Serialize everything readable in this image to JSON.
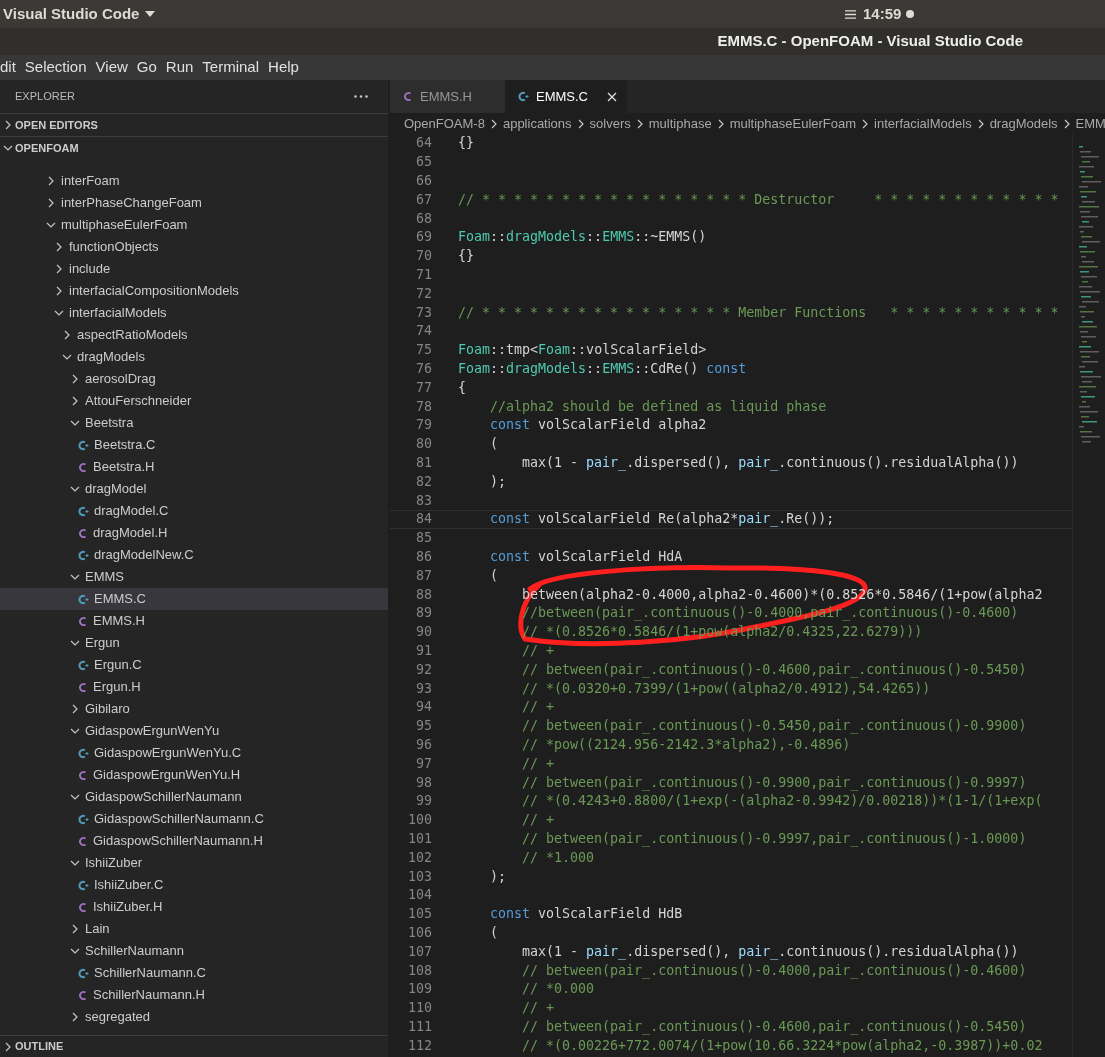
{
  "top_bar": {
    "app_menu": "Visual Studio Code",
    "clock": "14:59"
  },
  "window": {
    "title": "EMMS.C - OpenFOAM - Visual Studio Code"
  },
  "menu": [
    "dit",
    "Selection",
    "View",
    "Go",
    "Run",
    "Terminal",
    "Help"
  ],
  "sidebar": {
    "title": "EXPLORER",
    "sections": [
      {
        "label": "OPEN EDITORS",
        "expanded": false
      },
      {
        "label": "OPENFOAM",
        "expanded": true
      }
    ],
    "outline": {
      "label": "OUTLINE",
      "expanded": false
    },
    "tree": [
      {
        "label": "interFoam",
        "kind": "folder",
        "expanded": false,
        "selected": false
      },
      {
        "label": "interPhaseChangeFoam",
        "kind": "folder",
        "expanded": false,
        "selected": false
      },
      {
        "label": "multiphaseEulerFoam",
        "kind": "folder",
        "expanded": true,
        "selected": false,
        "children": [
          {
            "label": "functionObjects",
            "kind": "folder",
            "expanded": false,
            "selected": false
          },
          {
            "label": "include",
            "kind": "folder",
            "expanded": false,
            "selected": false
          },
          {
            "label": "interfacialCompositionModels",
            "kind": "folder",
            "expanded": false,
            "selected": false
          },
          {
            "label": "interfacialModels",
            "kind": "folder",
            "expanded": true,
            "selected": false,
            "children": [
              {
                "label": "aspectRatioModels",
                "kind": "folder",
                "expanded": false,
                "selected": false
              },
              {
                "label": "dragModels",
                "kind": "folder",
                "expanded": true,
                "selected": false,
                "children": [
                  {
                    "label": "aerosolDrag",
                    "kind": "folder",
                    "expanded": false,
                    "selected": false
                  },
                  {
                    "label": "AttouFerschneider",
                    "kind": "folder",
                    "expanded": false,
                    "selected": false
                  },
                  {
                    "label": "Beetstra",
                    "kind": "folder",
                    "expanded": true,
                    "selected": false,
                    "children": [
                      {
                        "label": "Beetstra.C",
                        "kind": "source",
                        "selected": false
                      },
                      {
                        "label": "Beetstra.H",
                        "kind": "header",
                        "selected": false
                      }
                    ]
                  },
                  {
                    "label": "dragModel",
                    "kind": "folder",
                    "expanded": true,
                    "selected": false,
                    "children": [
                      {
                        "label": "dragModel.C",
                        "kind": "source",
                        "selected": false
                      },
                      {
                        "label": "dragModel.H",
                        "kind": "header",
                        "selected": false
                      },
                      {
                        "label": "dragModelNew.C",
                        "kind": "source",
                        "selected": false
                      }
                    ]
                  },
                  {
                    "label": "EMMS",
                    "kind": "folder",
                    "expanded": true,
                    "selected": false,
                    "children": [
                      {
                        "label": "EMMS.C",
                        "kind": "source",
                        "selected": true
                      },
                      {
                        "label": "EMMS.H",
                        "kind": "header",
                        "selected": false
                      }
                    ]
                  },
                  {
                    "label": "Ergun",
                    "kind": "folder",
                    "expanded": true,
                    "selected": false,
                    "children": [
                      {
                        "label": "Ergun.C",
                        "kind": "source",
                        "selected": false
                      },
                      {
                        "label": "Ergun.H",
                        "kind": "header",
                        "selected": false
                      }
                    ]
                  },
                  {
                    "label": "Gibilaro",
                    "kind": "folder",
                    "expanded": false,
                    "selected": false
                  },
                  {
                    "label": "GidaspowErgunWenYu",
                    "kind": "folder",
                    "expanded": true,
                    "selected": false,
                    "children": [
                      {
                        "label": "GidaspowErgunWenYu.C",
                        "kind": "source",
                        "selected": false
                      },
                      {
                        "label": "GidaspowErgunWenYu.H",
                        "kind": "header",
                        "selected": false
                      }
                    ]
                  },
                  {
                    "label": "GidaspowSchillerNaumann",
                    "kind": "folder",
                    "expanded": true,
                    "selected": false,
                    "children": [
                      {
                        "label": "GidaspowSchillerNaumann.C",
                        "kind": "source",
                        "selected": false
                      },
                      {
                        "label": "GidaspowSchillerNaumann.H",
                        "kind": "header",
                        "selected": false
                      }
                    ]
                  },
                  {
                    "label": "IshiiZuber",
                    "kind": "folder",
                    "expanded": true,
                    "selected": false,
                    "children": [
                      {
                        "label": "IshiiZuber.C",
                        "kind": "source",
                        "selected": false
                      },
                      {
                        "label": "IshiiZuber.H",
                        "kind": "header",
                        "selected": false
                      }
                    ]
                  },
                  {
                    "label": "Lain",
                    "kind": "folder",
                    "expanded": false,
                    "selected": false
                  },
                  {
                    "label": "SchillerNaumann",
                    "kind": "folder",
                    "expanded": true,
                    "selected": false,
                    "children": [
                      {
                        "label": "SchillerNaumann.C",
                        "kind": "source",
                        "selected": false
                      },
                      {
                        "label": "SchillerNaumann.H",
                        "kind": "header",
                        "selected": false
                      }
                    ]
                  },
                  {
                    "label": "segregated",
                    "kind": "folder",
                    "expanded": false,
                    "selected": false
                  }
                ]
              }
            ]
          }
        ]
      }
    ]
  },
  "tabs": [
    {
      "label": "EMMS.H",
      "kind": "header",
      "selected": false
    },
    {
      "label": "EMMS.C",
      "kind": "source",
      "selected": true
    }
  ],
  "breadcrumbs": [
    "OpenFOAM-8",
    "applications",
    "solvers",
    "multiphase",
    "multiphaseEulerFoam",
    "interfacialModels",
    "dragModels",
    "EMM"
  ],
  "editor": {
    "lines": [
      {
        "number": "64",
        "current": false,
        "tokens": [
          {
            "text": "{}",
            "kind": "plain"
          }
        ]
      },
      {
        "number": "65",
        "current": false
      },
      {
        "number": "66",
        "current": false
      },
      {
        "number": "67",
        "current": false,
        "tokens": [
          {
            "text": "// * * * * * * * * * * * * * * * * * Destructor     * * * * * * * * * * * *",
            "kind": "comment"
          }
        ]
      },
      {
        "number": "68",
        "current": false
      },
      {
        "number": "69",
        "current": false,
        "tokens": [
          {
            "text": "Foam",
            "kind": "type"
          },
          {
            "text": "::",
            "kind": "plain"
          },
          {
            "text": "dragModels",
            "kind": "type"
          },
          {
            "text": "::",
            "kind": "plain"
          },
          {
            "text": "EMMS",
            "kind": "type"
          },
          {
            "text": "::~EMMS()",
            "kind": "plain"
          }
        ]
      },
      {
        "number": "70",
        "current": false,
        "tokens": [
          {
            "text": "{}",
            "kind": "plain"
          }
        ]
      },
      {
        "number": "71",
        "current": false
      },
      {
        "number": "72",
        "current": false
      },
      {
        "number": "73",
        "current": false,
        "tokens": [
          {
            "text": "// * * * * * * * * * * * * * * * * Member Functions   * * * * * * * * * * *",
            "kind": "comment"
          }
        ]
      },
      {
        "number": "74",
        "current": false
      },
      {
        "number": "75",
        "current": false,
        "tokens": [
          {
            "text": "Foam",
            "kind": "type"
          },
          {
            "text": "::tmp<",
            "kind": "plain"
          },
          {
            "text": "Foam",
            "kind": "type"
          },
          {
            "text": "::volScalarField>",
            "kind": "plain"
          }
        ]
      },
      {
        "number": "76",
        "current": false,
        "tokens": [
          {
            "text": "Foam",
            "kind": "type"
          },
          {
            "text": "::",
            "kind": "plain"
          },
          {
            "text": "dragModels",
            "kind": "type"
          },
          {
            "text": "::",
            "kind": "plain"
          },
          {
            "text": "EMMS",
            "kind": "type"
          },
          {
            "text": "::CdRe() ",
            "kind": "plain"
          },
          {
            "text": "const",
            "kind": "keyword"
          }
        ]
      },
      {
        "number": "77",
        "current": false,
        "tokens": [
          {
            "text": "{",
            "kind": "plain"
          }
        ]
      },
      {
        "number": "78",
        "current": false,
        "tokens": [
          {
            "text": "    //alpha2 should be defined as liquid phase",
            "kind": "comment"
          }
        ]
      },
      {
        "number": "79",
        "current": false,
        "tokens": [
          {
            "text": "    const",
            "kind": "keyword"
          },
          {
            "text": " volScalarField alpha2",
            "kind": "plain"
          }
        ]
      },
      {
        "number": "80",
        "current": false,
        "tokens": [
          {
            "text": "    (",
            "kind": "plain"
          }
        ]
      },
      {
        "number": "81",
        "current": false,
        "tokens": [
          {
            "text": "        max(1 - ",
            "kind": "plain"
          },
          {
            "text": "pair_",
            "kind": "variable"
          },
          {
            "text": ".dispersed(), ",
            "kind": "plain"
          },
          {
            "text": "pair_",
            "kind": "variable"
          },
          {
            "text": ".continuous().residualAlpha())",
            "kind": "plain"
          }
        ]
      },
      {
        "number": "82",
        "current": false,
        "tokens": [
          {
            "text": "    );",
            "kind": "plain"
          }
        ]
      },
      {
        "number": "83",
        "current": false
      },
      {
        "number": "84",
        "current": true,
        "tokens": [
          {
            "text": "    const",
            "kind": "keyword"
          },
          {
            "text": " volScalarField Re(alpha2*",
            "kind": "plain"
          },
          {
            "text": "pair_",
            "kind": "variable"
          },
          {
            "text": ".Re());",
            "kind": "plain"
          }
        ]
      },
      {
        "number": "85",
        "current": false
      },
      {
        "number": "86",
        "current": false,
        "tokens": [
          {
            "text": "    const",
            "kind": "keyword"
          },
          {
            "text": " volScalarField HdA",
            "kind": "plain"
          }
        ]
      },
      {
        "number": "87",
        "current": false,
        "tokens": [
          {
            "text": "    (",
            "kind": "plain"
          }
        ]
      },
      {
        "number": "88",
        "current": false,
        "tokens": [
          {
            "text": "        between(alpha2-0.4000,alpha2-0.4600)*(0.8526*0.5846/(1+pow(alpha2",
            "kind": "plain"
          }
        ]
      },
      {
        "number": "89",
        "current": false,
        "tokens": [
          {
            "text": "        //between(pair_.continuous()-0.4000,pair_.continuous()-0.4600)",
            "kind": "comment"
          }
        ]
      },
      {
        "number": "90",
        "current": false,
        "tokens": [
          {
            "text": "        // *(0.8526*0.5846/(1+pow(alpha2/0.4325,22.6279)))",
            "kind": "comment"
          }
        ]
      },
      {
        "number": "91",
        "current": false,
        "tokens": [
          {
            "text": "        // +",
            "kind": "comment"
          }
        ]
      },
      {
        "number": "92",
        "current": false,
        "tokens": [
          {
            "text": "        // between(pair_.continuous()-0.4600,pair_.continuous()-0.5450)",
            "kind": "comment"
          }
        ]
      },
      {
        "number": "93",
        "current": false,
        "tokens": [
          {
            "text": "        // *(0.0320+0.7399/(1+pow((alpha2/0.4912),54.4265))",
            "kind": "comment"
          }
        ]
      },
      {
        "number": "94",
        "current": false,
        "tokens": [
          {
            "text": "        // +",
            "kind": "comment"
          }
        ]
      },
      {
        "number": "95",
        "current": false,
        "tokens": [
          {
            "text": "        // between(pair_.continuous()-0.5450,pair_.continuous()-0.9900)",
            "kind": "comment"
          }
        ]
      },
      {
        "number": "96",
        "current": false,
        "tokens": [
          {
            "text": "        // *pow((2124.956-2142.3*alpha2),-0.4896)",
            "kind": "comment"
          }
        ]
      },
      {
        "number": "97",
        "current": false,
        "tokens": [
          {
            "text": "        // +",
            "kind": "comment"
          }
        ]
      },
      {
        "number": "98",
        "current": false,
        "tokens": [
          {
            "text": "        // between(pair_.continuous()-0.9900,pair_.continuous()-0.9997)",
            "kind": "comment"
          }
        ]
      },
      {
        "number": "99",
        "current": false,
        "tokens": [
          {
            "text": "        // *(0.4243+0.8800/(1+exp(-(alpha2-0.9942)/0.00218))*(1-1/(1+exp(",
            "kind": "comment"
          }
        ]
      },
      {
        "number": "100",
        "current": false,
        "tokens": [
          {
            "text": "        // +",
            "kind": "comment"
          }
        ]
      },
      {
        "number": "101",
        "current": false,
        "tokens": [
          {
            "text": "        // between(pair_.continuous()-0.9997,pair_.continuous()-1.0000)",
            "kind": "comment"
          }
        ]
      },
      {
        "number": "102",
        "current": false,
        "tokens": [
          {
            "text": "        // *1.000",
            "kind": "comment"
          }
        ]
      },
      {
        "number": "103",
        "current": false,
        "tokens": [
          {
            "text": "    );",
            "kind": "plain"
          }
        ]
      },
      {
        "number": "104",
        "current": false
      },
      {
        "number": "105",
        "current": false,
        "tokens": [
          {
            "text": "    const",
            "kind": "keyword"
          },
          {
            "text": " volScalarField HdB",
            "kind": "plain"
          }
        ]
      },
      {
        "number": "106",
        "current": false,
        "tokens": [
          {
            "text": "    (",
            "kind": "plain"
          }
        ]
      },
      {
        "number": "107",
        "current": false,
        "tokens": [
          {
            "text": "        max(1 - ",
            "kind": "plain"
          },
          {
            "text": "pair_",
            "kind": "variable"
          },
          {
            "text": ".dispersed(), ",
            "kind": "plain"
          },
          {
            "text": "pair_",
            "kind": "variable"
          },
          {
            "text": ".continuous().residualAlpha())",
            "kind": "plain"
          }
        ]
      },
      {
        "number": "108",
        "current": false,
        "tokens": [
          {
            "text": "        // between(pair_.continuous()-0.4000,pair_.continuous()-0.4600)",
            "kind": "comment"
          }
        ]
      },
      {
        "number": "109",
        "current": false,
        "tokens": [
          {
            "text": "        // *0.000",
            "kind": "comment"
          }
        ]
      },
      {
        "number": "110",
        "current": false,
        "tokens": [
          {
            "text": "        // +",
            "kind": "comment"
          }
        ]
      },
      {
        "number": "111",
        "current": false,
        "tokens": [
          {
            "text": "        // between(pair_.continuous()-0.4600,pair_.continuous()-0.5450)",
            "kind": "comment"
          }
        ]
      },
      {
        "number": "112",
        "current": false,
        "tokens": [
          {
            "text": "        // *(0.00226+772.0074/(1+pow(10.66.3224*pow(alpha2,-0.3987))+0.02",
            "kind": "comment"
          }
        ]
      }
    ]
  }
}
